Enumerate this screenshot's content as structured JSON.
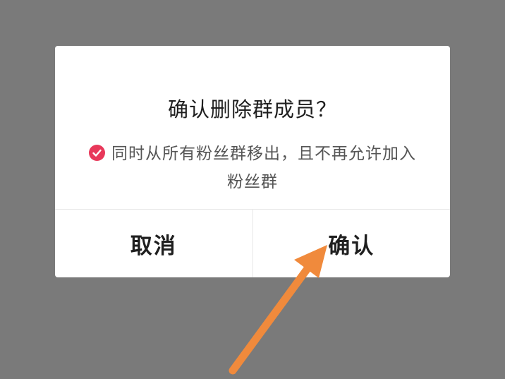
{
  "dialog": {
    "title": "确认删除群成员？",
    "option_text": "同时从所有粉丝群移出，且不再允许加入粉丝群",
    "option_checked": true,
    "cancel_label": "取消",
    "confirm_label": "确认"
  },
  "colors": {
    "overlay": "#7a7a7a",
    "check_accent": "#e8385a",
    "arrow": "#f08a3c"
  },
  "annotation": {
    "icon": "arrow-pointer-icon"
  }
}
